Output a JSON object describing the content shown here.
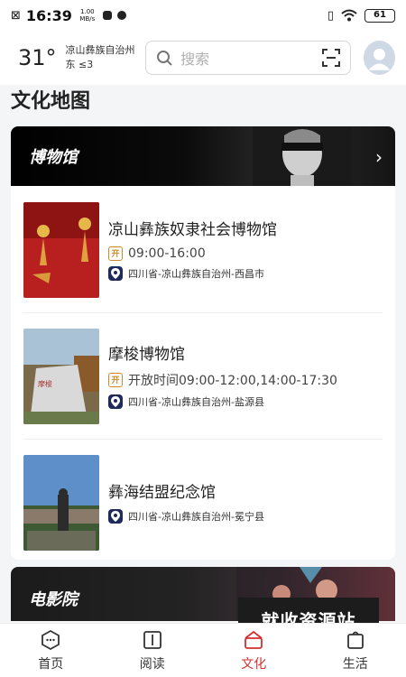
{
  "status_bar": {
    "time": "16:39",
    "speed_value": "1.00",
    "speed_unit": "MB/s",
    "battery": "61"
  },
  "header": {
    "temperature": "31°",
    "location": "凉山彝族自治州",
    "wind": "东 ≤3",
    "search_placeholder": "搜索"
  },
  "section": {
    "title": "文化地图"
  },
  "museum_card": {
    "banner_title": "博物馆",
    "items": [
      {
        "name": "凉山彝族奴隶社会博物馆",
        "hours": "09:00-16:00",
        "address": "四川省-凉山彝族自治州-西昌市"
      },
      {
        "name": "摩梭博物馆",
        "hours": "开放时间09:00-12:00,14:00-17:30",
        "address": "四川省-凉山彝族自治州-盐源县"
      },
      {
        "name": "彝海结盟纪念馆",
        "address": "四川省-凉山彝族自治州-冕宁县"
      }
    ]
  },
  "cinema_card": {
    "banner_title": "电影院"
  },
  "watermark": "就收资源站",
  "bottom_nav": [
    {
      "label": "首页",
      "icon": "home-icon"
    },
    {
      "label": "阅读",
      "icon": "book-icon"
    },
    {
      "label": "文化",
      "icon": "culture-icon",
      "active": true
    },
    {
      "label": "生活",
      "icon": "life-icon"
    }
  ],
  "colors": {
    "active": "#d32f2f",
    "location_badge": "#1e2a5a",
    "open_badge": "#d08a2a"
  }
}
